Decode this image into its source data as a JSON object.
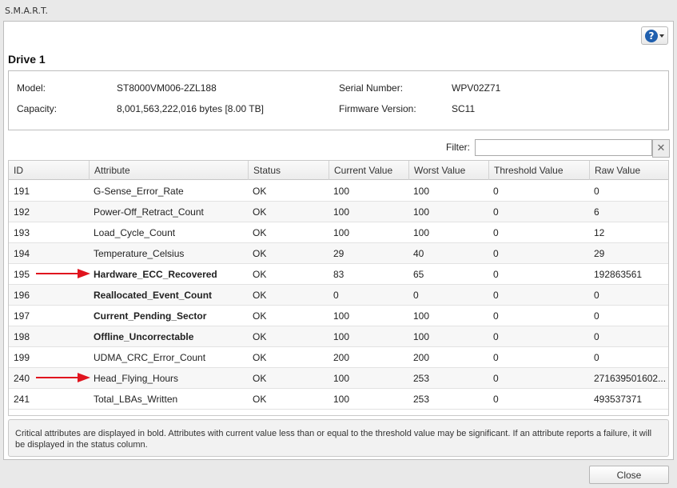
{
  "window": {
    "title": "S.M.A.R.T."
  },
  "header": {
    "drive_title": "Drive 1"
  },
  "info": {
    "model_label": "Model:",
    "model_value": "ST8000VM006-2ZL188",
    "serial_label": "Serial Number:",
    "serial_value": "WPV02Z71",
    "capacity_label": "Capacity:",
    "capacity_value": "8,001,563,222,016 bytes [8.00 TB]",
    "firmware_label": "Firmware Version:",
    "firmware_value": "SC11"
  },
  "filter": {
    "label": "Filter:",
    "value": "",
    "placeholder": ""
  },
  "table": {
    "columns": [
      "ID",
      "Attribute",
      "Status",
      "Current Value",
      "Worst Value",
      "Threshold Value",
      "Raw Value"
    ],
    "rows": [
      {
        "id": "191",
        "attribute": "G-Sense_Error_Rate",
        "status": "OK",
        "current": "100",
        "worst": "100",
        "threshold": "0",
        "raw": "0",
        "critical": false
      },
      {
        "id": "192",
        "attribute": "Power-Off_Retract_Count",
        "status": "OK",
        "current": "100",
        "worst": "100",
        "threshold": "0",
        "raw": "6",
        "critical": false
      },
      {
        "id": "193",
        "attribute": "Load_Cycle_Count",
        "status": "OK",
        "current": "100",
        "worst": "100",
        "threshold": "0",
        "raw": "12",
        "critical": false
      },
      {
        "id": "194",
        "attribute": "Temperature_Celsius",
        "status": "OK",
        "current": "29",
        "worst": "40",
        "threshold": "0",
        "raw": "29",
        "critical": false
      },
      {
        "id": "195",
        "attribute": "Hardware_ECC_Recovered",
        "status": "OK",
        "current": "83",
        "worst": "65",
        "threshold": "0",
        "raw": "192863561",
        "critical": true
      },
      {
        "id": "196",
        "attribute": "Reallocated_Event_Count",
        "status": "OK",
        "current": "0",
        "worst": "0",
        "threshold": "0",
        "raw": "0",
        "critical": true
      },
      {
        "id": "197",
        "attribute": "Current_Pending_Sector",
        "status": "OK",
        "current": "100",
        "worst": "100",
        "threshold": "0",
        "raw": "0",
        "critical": true
      },
      {
        "id": "198",
        "attribute": "Offline_Uncorrectable",
        "status": "OK",
        "current": "100",
        "worst": "100",
        "threshold": "0",
        "raw": "0",
        "critical": true
      },
      {
        "id": "199",
        "attribute": "UDMA_CRC_Error_Count",
        "status": "OK",
        "current": "200",
        "worst": "200",
        "threshold": "0",
        "raw": "0",
        "critical": false
      },
      {
        "id": "240",
        "attribute": "Head_Flying_Hours",
        "status": "OK",
        "current": "100",
        "worst": "253",
        "threshold": "0",
        "raw": "271639501602...",
        "critical": false
      },
      {
        "id": "241",
        "attribute": "Total_LBAs_Written",
        "status": "OK",
        "current": "100",
        "worst": "253",
        "threshold": "0",
        "raw": "493537371",
        "critical": false
      }
    ]
  },
  "annotations": {
    "arrow_color": "#e0141e"
  },
  "note": {
    "text": "Critical attributes are displayed in bold. Attributes with current value less than or equal to the threshold value may be significant. If an attribute reports a failure, it will be displayed in the status column."
  },
  "footer": {
    "close_label": "Close"
  },
  "icons": {
    "help": "help-icon",
    "clear": "clear-x-icon"
  },
  "colors": {
    "help_blue": "#1f5fae"
  }
}
